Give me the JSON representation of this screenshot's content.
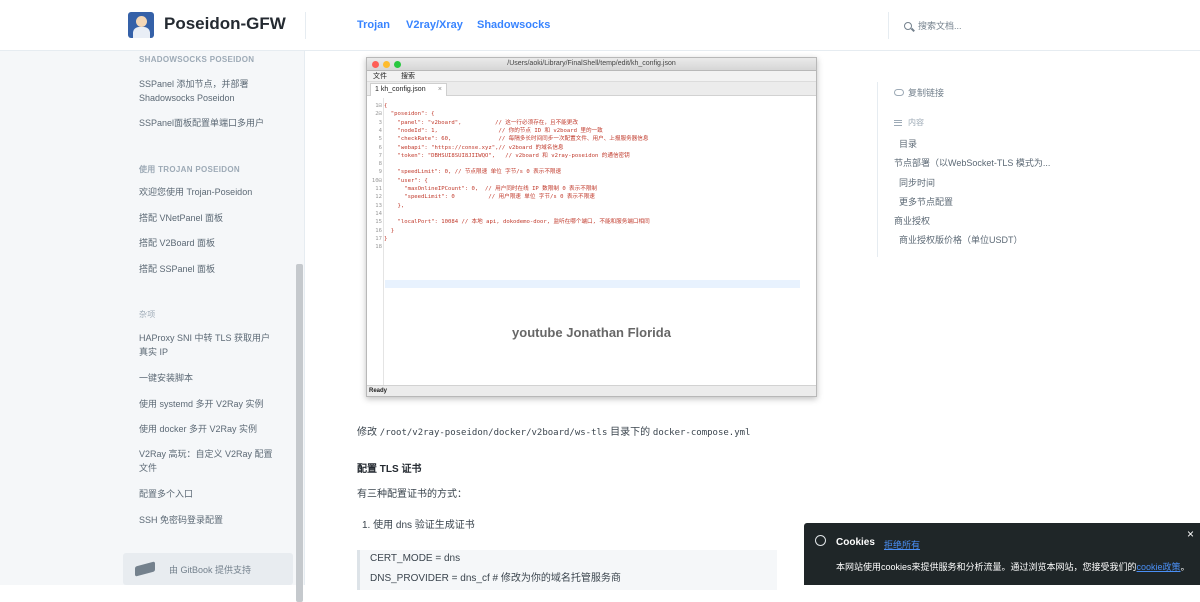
{
  "header": {
    "site_title": "Poseidon-GFW",
    "nav": [
      "Trojan",
      "V2ray/Xray",
      "Shadowsocks"
    ],
    "search_placeholder": "搜索文档..."
  },
  "sidebar": {
    "section1": "SHADOWSOCKS POSEIDON",
    "item_sspanel_add": "SSPanel 添加节点，并部署 Shadowsocks Poseidon",
    "item_sspanel_port": "SSPanel面板配置单端口多用户",
    "section2": "使用 TROJAN POSEIDON",
    "item_welcome": "欢迎您使用 Trojan-Poseidon",
    "item_vnet": "搭配 VNetPanel 面板",
    "item_v2board": "搭配 V2Board 面板",
    "item_sspanel": "搭配 SSPanel 面板",
    "section3": "杂项",
    "item_haproxy": "HAProxy SNI 中转 TLS 获取用户真实 IP",
    "item_install": "一键安装脚本",
    "item_systemd": "使用 systemd 多开 V2Ray 实例",
    "item_docker": "使用 docker 多开 V2Ray 实例",
    "item_v2ray_adv": "V2Ray 高玩：自定义 V2Ray 配置文件",
    "item_multi_entry": "配置多个入口",
    "item_ssh": "SSH 免密码登录配置",
    "gitbook": "由 GitBook 提供支持"
  },
  "screenshot": {
    "path": "/Users/aoki/Library/FinalShell/temp/edit/kh_config.json",
    "menu": [
      "文件",
      "搜索"
    ],
    "tab": "1 kh_config.json",
    "tab_close": "×",
    "lines": [
      {
        "n": "1⊟",
        "t": "{"
      },
      {
        "n": "2⊟",
        "t": "  \"poseidon\": {"
      },
      {
        "n": "3",
        "t": "    \"panel\": \"v2board\",          // 这一行必须存在，且不能更改"
      },
      {
        "n": "4",
        "t": "    \"nodeId\": 1,                  // 你的节点 ID 和 v2board 里的一致"
      },
      {
        "n": "5",
        "t": "    \"checkRate\": 60,              // 每隔多长时间同步一次配置文件、用户、上报服务器信息"
      },
      {
        "n": "6",
        "t": "    \"webapi\": \"https://conse.xyz\",// v2board 的域名信息"
      },
      {
        "n": "7",
        "t": "    \"token\": \"DBHSUI8SUI8JIIWQO\",   // v2board 和 v2ray-poseidon 的通信密钥"
      },
      {
        "n": "8",
        "t": ""
      },
      {
        "n": "9",
        "t": "    \"speedLimit\": 0, // 节点限速 单位 字节/s 0 表示不限速"
      },
      {
        "n": "10⊟",
        "t": "    \"user\": {"
      },
      {
        "n": "11",
        "t": "      \"maxOnlineIPCount\": 0,  // 用户同时在线 IP 数限制 0 表示不限制"
      },
      {
        "n": "12",
        "t": "      \"speedLimit\": 0          // 用户限速 单位 字节/s 0 表示不限速"
      },
      {
        "n": "13",
        "t": "    },"
      },
      {
        "n": "14",
        "t": ""
      },
      {
        "n": "15",
        "t": "    \"localPort\": 10084 // 本地 api, dokodemo-door, 监听在哪个端口, 不能和服务端口相同"
      },
      {
        "n": "16",
        "t": "  }"
      },
      {
        "n": "17",
        "t": "}"
      },
      {
        "n": "18",
        "t": ""
      }
    ],
    "watermark": "youtube Jonathan Florida",
    "status": "Ready"
  },
  "content": {
    "modify_prefix": "修改",
    "modify_path": "/root/v2ray-poseidon/docker/v2board/ws-tls",
    "modify_mid": "目录下的",
    "modify_file": "docker-compose.yml",
    "tls_heading": "配置 TLS 证书",
    "tls_intro": "有三种配置证书的方式：",
    "tls_item1": "1.  使用 dns 验证生成证书",
    "code1": "CERT_MODE = dns",
    "code2": "DNS_PROVIDER = dns_cf # 修改为你的域名托管服务商"
  },
  "toc": {
    "copy_link": "复制链接",
    "heading": "内容",
    "items": [
      "目录",
      "节点部署（以WebSocket-TLS 模式为...",
      "同步时间",
      "更多节点配置",
      "商业授权",
      "商业授权版价格（单位USDT）"
    ]
  },
  "cookie": {
    "title": "Cookies",
    "reject": "拒绝所有",
    "close": "×",
    "text": "本网站使用cookies来提供服务和分析流量。通过浏览本网站，您接受我们的",
    "link": "cookie政策",
    "end": "。"
  },
  "colors": {
    "accent": "#3884ff",
    "cookie_bg": "#1f2628",
    "key": "#c0392b",
    "string": "#c0392b",
    "number": "#7a3fbf",
    "comment": "#111111"
  }
}
